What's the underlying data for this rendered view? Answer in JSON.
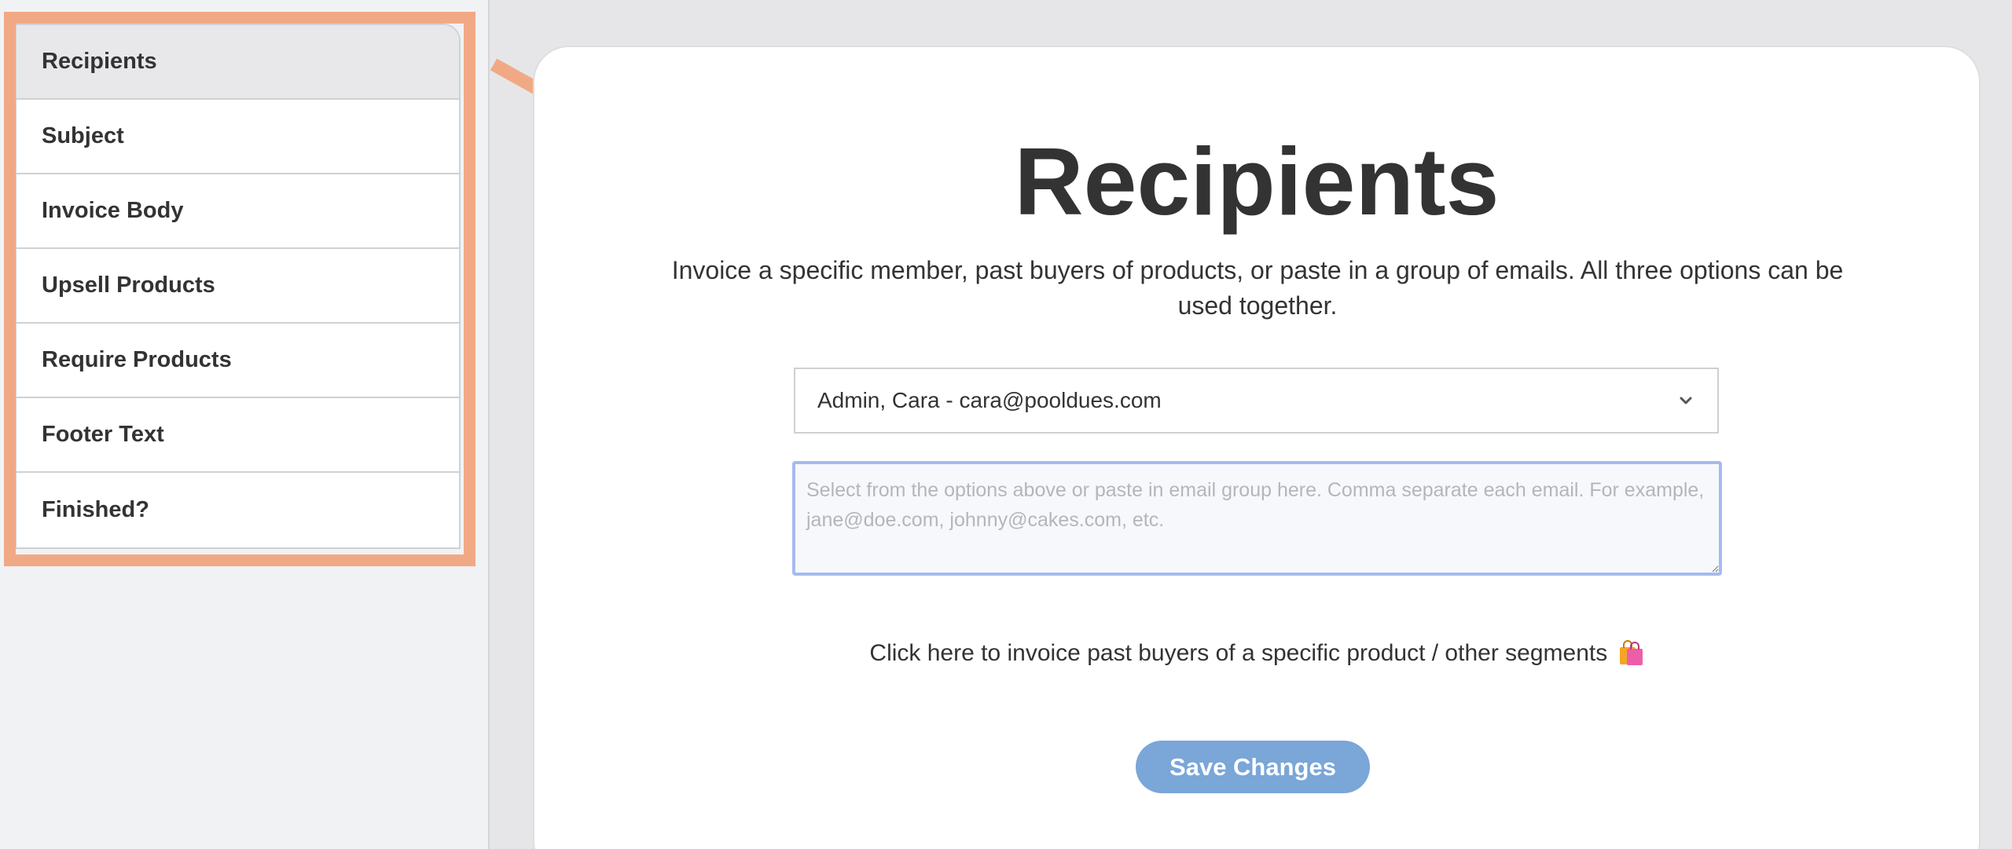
{
  "sidebar": {
    "items": [
      {
        "label": "Recipients",
        "active": true
      },
      {
        "label": "Subject",
        "active": false
      },
      {
        "label": "Invoice Body",
        "active": false
      },
      {
        "label": "Upsell Products",
        "active": false
      },
      {
        "label": "Require Products",
        "active": false
      },
      {
        "label": "Footer Text",
        "active": false
      },
      {
        "label": "Finished?",
        "active": false
      }
    ]
  },
  "annotation": {
    "highlight_color": "#f1a985"
  },
  "main": {
    "title": "Recipients",
    "description": "Invoice a specific member, past buyers of products, or paste in a group of emails. All three options can be used together.",
    "member_select": {
      "selected": "Admin, Cara - cara@pooldues.com"
    },
    "email_group": {
      "value": "",
      "placeholder": "Select from the options above or paste in email group here. Comma separate each email. For example, jane@doe.com, johnny@cakes.com, etc."
    },
    "segments_link": "Click here to invoice past buyers of a specific product / other segments",
    "segments_icon": "shopping-bags-icon",
    "save_button": "Save Changes"
  },
  "colors": {
    "accent": "#7aa6d8",
    "textarea_focus": "#a7baf0",
    "text": "#333333"
  }
}
